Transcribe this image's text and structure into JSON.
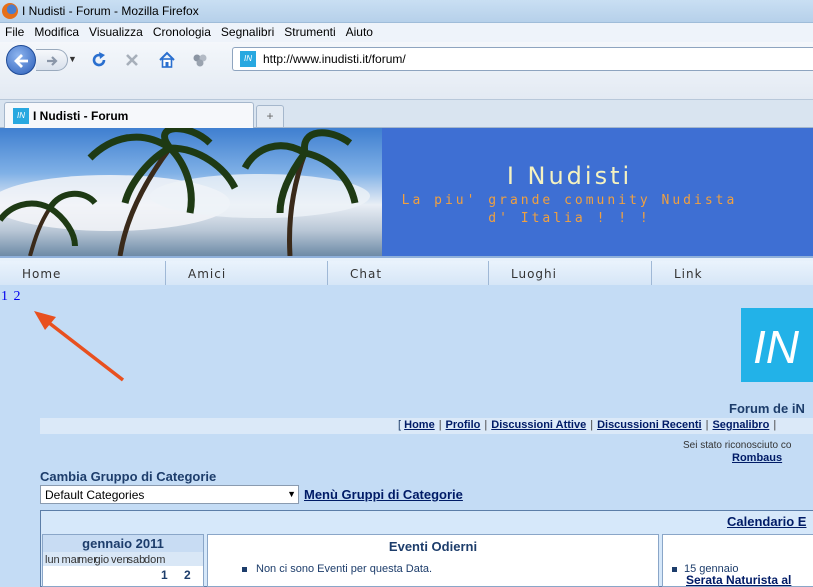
{
  "window": {
    "title": "I Nudisti - Forum - Mozilla Firefox"
  },
  "menu": [
    "File",
    "Modifica",
    "Visualizza",
    "Cronologia",
    "Segnalibri",
    "Strumenti",
    "Aiuto"
  ],
  "toolbar": {
    "icons": [
      "back-icon",
      "forward-icon",
      "reload-icon",
      "stop-icon",
      "home-icon",
      "addons-icon"
    ],
    "url": "http://www.inudisti.it/forum/"
  },
  "favicon_text": "IN",
  "tab": {
    "label": "I Nudisti - Forum",
    "new_tab_glyph": "+"
  },
  "banner": {
    "title": "I Nudisti",
    "subtitle_line1": "La piu' grande comunity Nudista",
    "subtitle_line2": "d' Italia ! ! !"
  },
  "site_nav": [
    "Home",
    "Amici",
    "Chat",
    "Luoghi",
    "Link"
  ],
  "pager": [
    "1",
    "2"
  ],
  "logo_text": "IN",
  "forum": {
    "title": "Forum de iN",
    "links": [
      "Home",
      "Profilo",
      "Discussioni Attive",
      "Discussioni Recenti",
      "Segnalibro"
    ],
    "links_open": "[",
    "links_sep": "|",
    "recognized_text": "Sei stato riconosciuto co",
    "user": "Rombaus"
  },
  "category_group": {
    "label": "Cambia Gruppo di Categorie",
    "selected": "Default Categories",
    "menu_link": "Menù Gruppi di Categorie"
  },
  "calendar": {
    "header_link": "Calendario E",
    "month": "gennaio 2011",
    "weekdays": [
      "lun",
      "mar",
      "mer",
      "gio",
      "ven",
      "sab",
      "dom"
    ],
    "first_dates": [
      "1",
      "2"
    ],
    "events_today_title": "Eventi Odierni",
    "events_today_empty": "Non ci sono Eventi per questa Data.",
    "upcoming_date": "15 gennaio",
    "upcoming_event": "Serata Naturista al"
  },
  "colors": {
    "page_bg": "#c4dcf5",
    "banner_bg": "#3e6fd3",
    "logo_bg": "#22b2e8",
    "link": "#001b66",
    "annotation_arrow": "#e8501f"
  }
}
